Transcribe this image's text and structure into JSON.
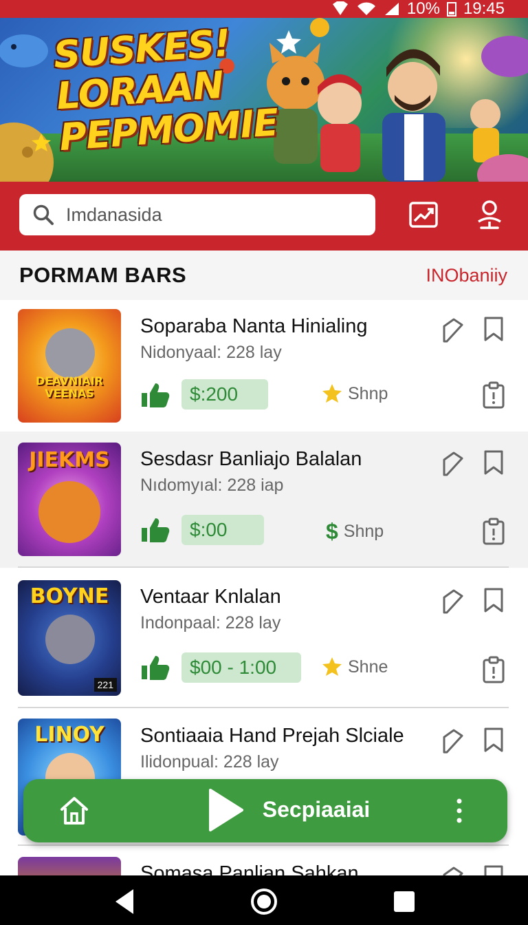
{
  "status_bar": {
    "battery": "10%",
    "time": "19:45"
  },
  "banner": {
    "title_lines": [
      "SUSKES!",
      "LORAAN",
      "PEPMOMIE"
    ]
  },
  "search": {
    "value": "Imdanasida"
  },
  "section": {
    "title": "PORMAM BARS",
    "link": "INObaniiy"
  },
  "items": [
    {
      "title": "Soparaba  Nanta Hinialing",
      "subtitle": "Nidonyaal: 228 lay",
      "price": "$:200",
      "rating_label": "Shnp",
      "rating_icon": "star-icon",
      "thumb_text": "DEAVNIAIR VEENAS"
    },
    {
      "title": "Sesdasr Banliajo Balalan",
      "subtitle": "Nıdomyıal: 228 iap",
      "price": "$:00",
      "rating_label": "Shnp",
      "rating_icon": "dollar-icon",
      "thumb_text": "JIEKMS"
    },
    {
      "title": "Ventaar Knlalan",
      "subtitle": "Indonpaal: 228 lay",
      "price": "$00 - 1:00",
      "rating_label": "Shne",
      "rating_icon": "star-icon",
      "thumb_text": "BOYNE",
      "thumb_badge": "221"
    },
    {
      "title": "Sontiaaia Hand Prejah Slciale",
      "subtitle": "Ilidonpual: 228 lay",
      "thumb_text": "LINOY"
    },
    {
      "title": "Somasa Panlian Sahkan"
    }
  ],
  "fab": {
    "label": "Secpiaaiai"
  },
  "colors": {
    "brand_red": "#c8262c",
    "accent_green": "#3f9b3f",
    "price_bg": "#cde8cf"
  },
  "icons": {
    "header": [
      "trending-chart-icon",
      "profile-icon"
    ],
    "item_actions": [
      "tag-icon",
      "bookmark-icon",
      "clipboard-icon"
    ],
    "nav": [
      "back-icon",
      "home-icon",
      "recents-icon"
    ]
  }
}
